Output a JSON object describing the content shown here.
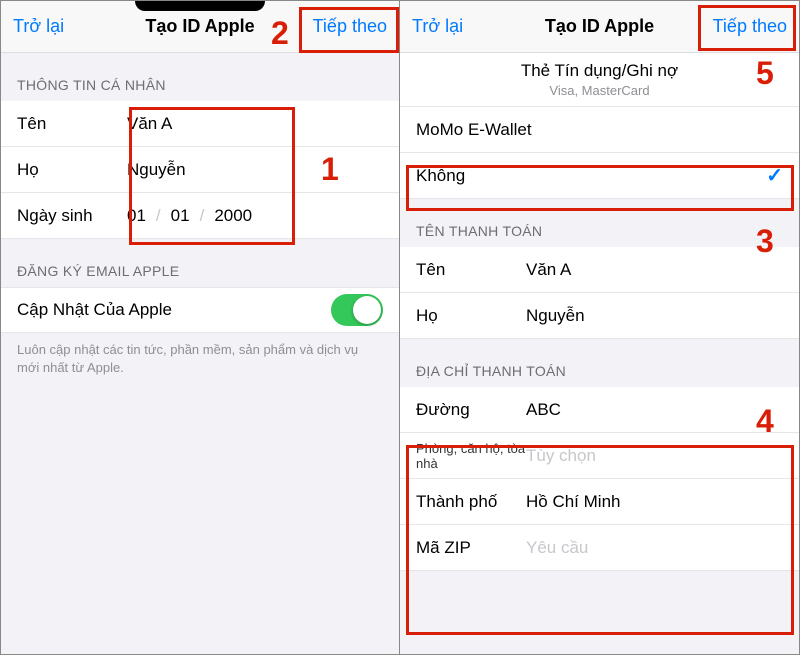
{
  "left": {
    "nav": {
      "back": "Trở lại",
      "title": "Tạo ID Apple",
      "next": "Tiếp theo"
    },
    "section_personal": "THÔNG TIN CÁ NHÂN",
    "first_name_label": "Tên",
    "first_name_value": "Văn A",
    "last_name_label": "Họ",
    "last_name_value": "Nguyễn",
    "dob_label": "Ngày sinh",
    "dob_day": "01",
    "dob_month": "01",
    "dob_year": "2000",
    "section_email": "ĐĂNG KÝ EMAIL APPLE",
    "updates_label": "Cập Nhật Của Apple",
    "updates_note": "Luôn cập nhật các tin tức, phần mềm, sản phẩm và dịch vụ mới nhất từ Apple."
  },
  "right": {
    "nav": {
      "back": "Trở lại",
      "title": "Tạo ID Apple",
      "next": "Tiếp theo"
    },
    "card_title": "Thẻ Tín dụng/Ghi nợ",
    "card_sub": "Visa, MasterCard",
    "momo": "MoMo E-Wallet",
    "none": "Không",
    "section_billing_name": "TÊN THANH TOÁN",
    "bn_first_label": "Tên",
    "bn_first_value": "Văn A",
    "bn_last_label": "Họ",
    "bn_last_value": "Nguyễn",
    "section_billing_addr": "ĐỊA CHỈ THANH TOÁN",
    "street_label": "Đường",
    "street_value": "ABC",
    "apt_label": "Phòng, căn hộ, tòa nhà",
    "apt_placeholder": "Tùy chọn",
    "city_label": "Thành phố",
    "city_value": "Hồ Chí Minh",
    "zip_label": "Mã ZIP",
    "zip_placeholder": "Yêu cầu"
  },
  "anno": {
    "n1": "1",
    "n2": "2",
    "n3": "3",
    "n4": "4",
    "n5": "5"
  }
}
